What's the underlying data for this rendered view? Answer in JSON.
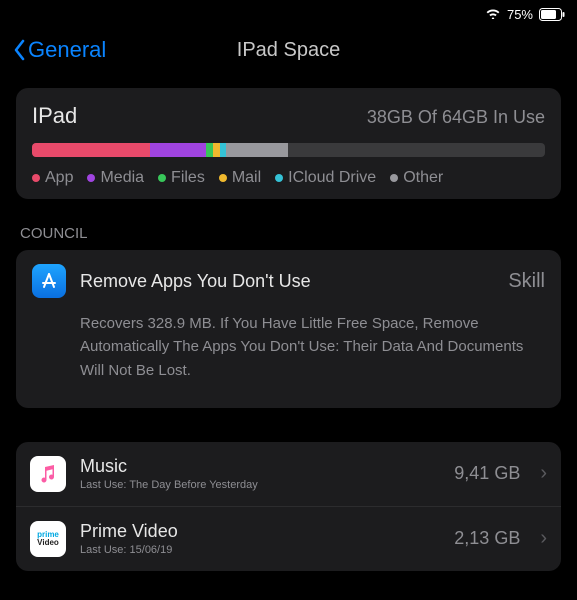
{
  "status": {
    "battery_pct": "75%"
  },
  "nav": {
    "back_label": "General",
    "title": "IPad Space"
  },
  "storage": {
    "device": "IPad",
    "used_text": "38GB Of 64GB In Use",
    "segments": [
      {
        "name": "App",
        "color": "#e84a6a",
        "pct": 23
      },
      {
        "name": "Media",
        "color": "#a044e0",
        "pct": 11
      },
      {
        "name": "Files",
        "color": "#38c75a",
        "pct": 1.3
      },
      {
        "name": "Mail",
        "color": "#f0b92e",
        "pct": 1.3
      },
      {
        "name": "ICloud Drive",
        "color": "#35c2d6",
        "pct": 1.3
      },
      {
        "name": "Other",
        "color": "#98989d",
        "pct": 12
      }
    ],
    "legend": [
      "App",
      "Media",
      "Files",
      "Mail",
      "ICloud Drive",
      "Other"
    ]
  },
  "section_label": "COUNCIL",
  "tip": {
    "title": "Remove Apps You Don't Use",
    "action": "Skill",
    "desc": "Recovers 328.9 MB. If You Have Little Free Space, Remove Automatically The Apps You Don't Use: Their Data And Documents Will Not Be Lost."
  },
  "apps": [
    {
      "name": "Music",
      "sub": "Last Use: The Day Before Yesterday",
      "size": "9,41 GB",
      "icon": "music"
    },
    {
      "name": "Prime Video",
      "sub": "Last Use: 15/06/19",
      "size": "2,13 GB",
      "icon": "prime"
    }
  ]
}
